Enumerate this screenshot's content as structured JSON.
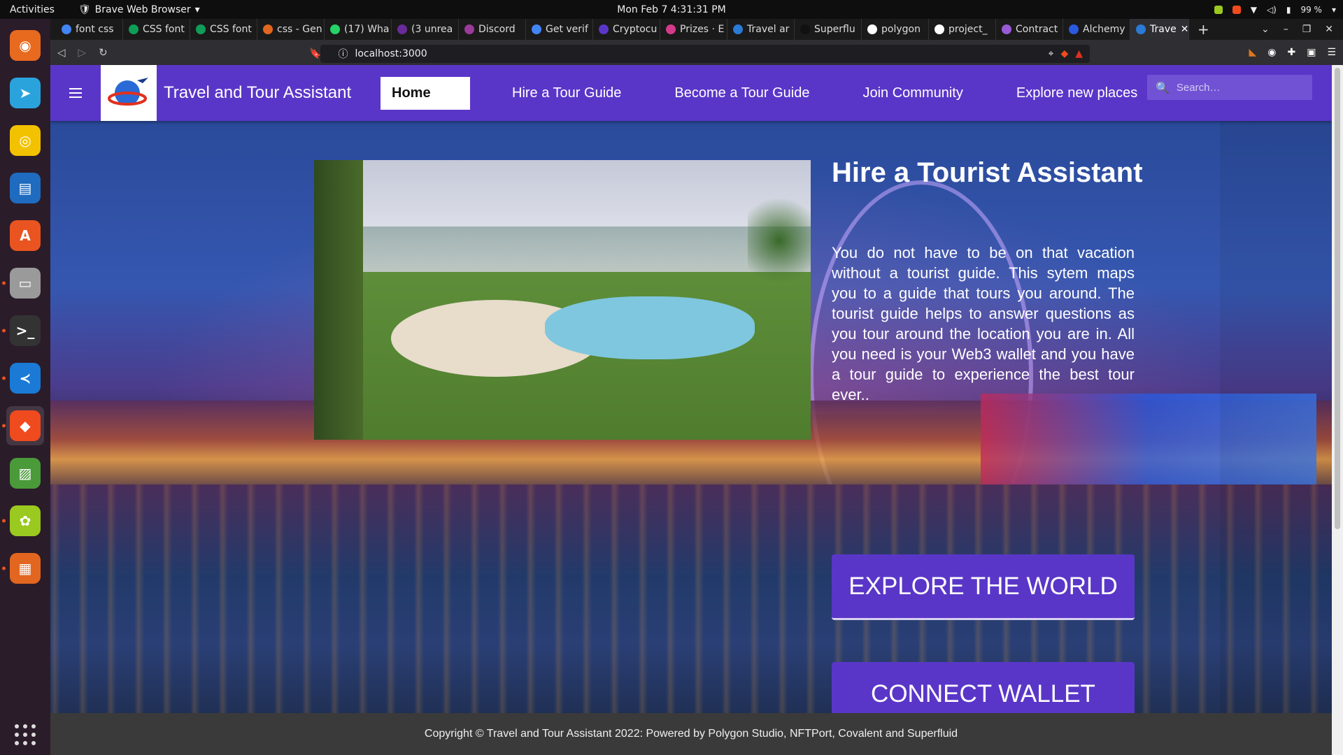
{
  "system": {
    "activities": "Activities",
    "app_name": "Brave Web Browser",
    "clock": "Mon Feb 7   4:31:31 PM",
    "battery": "99 %"
  },
  "dock": {
    "items": [
      {
        "name": "firefox",
        "color": "#e86a1f",
        "glyph": "◉"
      },
      {
        "name": "telegram",
        "color": "#2aa3dd",
        "glyph": "➤"
      },
      {
        "name": "rhythmbox",
        "color": "#f2c200",
        "glyph": "◎"
      },
      {
        "name": "writer",
        "color": "#1f6bbf",
        "glyph": "▤"
      },
      {
        "name": "software",
        "color": "#e95420",
        "glyph": "A"
      },
      {
        "name": "files",
        "color": "#9a9a9a",
        "glyph": "▭"
      },
      {
        "name": "terminal",
        "color": "#333333",
        "glyph": ">_"
      },
      {
        "name": "vscode",
        "color": "#1a7ad6",
        "glyph": "≺"
      },
      {
        "name": "brave",
        "color": "#f04a1f",
        "glyph": "◆"
      },
      {
        "name": "image-viewer",
        "color": "#4a9a3a",
        "glyph": "▨"
      },
      {
        "name": "polygon-app",
        "color": "#9ac91f",
        "glyph": "✿"
      },
      {
        "name": "presentation",
        "color": "#e2661f",
        "glyph": "▦"
      }
    ]
  },
  "tabs": [
    {
      "title": "font css",
      "color": "#4285f4"
    },
    {
      "title": "CSS font",
      "color": "#0f9d58"
    },
    {
      "title": "CSS font",
      "color": "#0f9d58"
    },
    {
      "title": "css - Gen",
      "color": "#e2661f"
    },
    {
      "title": "(17) Wha",
      "color": "#25d366"
    },
    {
      "title": "(3 unrea",
      "color": "#6a2a9a"
    },
    {
      "title": "Discord",
      "color": "#9a3a9a"
    },
    {
      "title": "Get verif",
      "color": "#4285f4"
    },
    {
      "title": "Cryptocu",
      "color": "#5a36c8"
    },
    {
      "title": "Prizes · E",
      "color": "#d43a8a"
    },
    {
      "title": "Travel ar",
      "color": "#2a7ad6"
    },
    {
      "title": "Superflu",
      "color": "#111111"
    },
    {
      "title": "polygon",
      "color": "#ffffff"
    },
    {
      "title": "project_",
      "color": "#ffffff"
    },
    {
      "title": "Contract",
      "color": "#9a5ad6"
    },
    {
      "title": "Alchemy",
      "color": "#2a5ae0"
    },
    {
      "title": "Trave",
      "color": "#2a7ad6",
      "active": true
    }
  ],
  "address": {
    "url": "localhost:3000"
  },
  "site": {
    "brand": "Travel and Tour Assistant",
    "nav": [
      "Home",
      "Hire a Tour Guide",
      "Become a Tour Guide",
      "Join Community",
      "Explore new places"
    ],
    "search_placeholder": "Search…",
    "hero": {
      "title": "Hire a Tourist Assistant",
      "description": "You do not have to be on that vacation without a tourist guide. This sytem maps you to a guide that tours you around. The tourist guide helps to answer questions as you tour around the location you are in. All you need is your Web3 wallet and you have a tour guide to experience the best tour ever.."
    },
    "buttons": {
      "explore": "EXPLORE THE WORLD",
      "connect": "CONNECT WALLET"
    },
    "footer": "Copyright © Travel and Tour Assistant 2022: Powered by Polygon Studio, NFTPort, Covalent and Superfluid"
  },
  "colors": {
    "primary": "#5a36c8",
    "footer_bg": "#3a3a3a"
  }
}
